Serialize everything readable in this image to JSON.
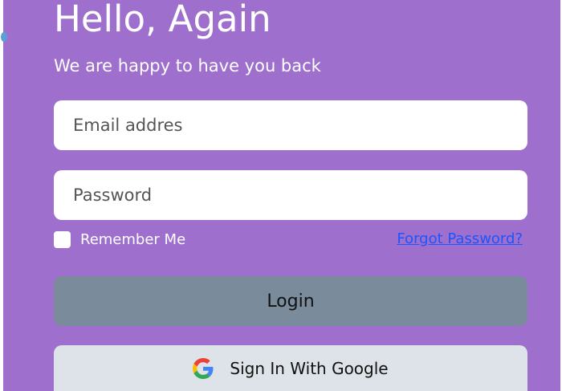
{
  "header": {
    "title": "Hello, Again",
    "subtitle": "We are happy to have you back"
  },
  "form": {
    "email_placeholder": "Email addres",
    "password_placeholder": "Password",
    "remember_label": "Remember Me",
    "forgot_label": "Forgot Password?",
    "login_label": "Login",
    "google_label": "Sign In With Google"
  },
  "colors": {
    "panel_bg": "#9e6fcc",
    "login_bg": "#7a8b9c",
    "google_bg": "#dde3e8",
    "link": "#1a55ff"
  },
  "icons": {
    "google": "google-icon"
  }
}
